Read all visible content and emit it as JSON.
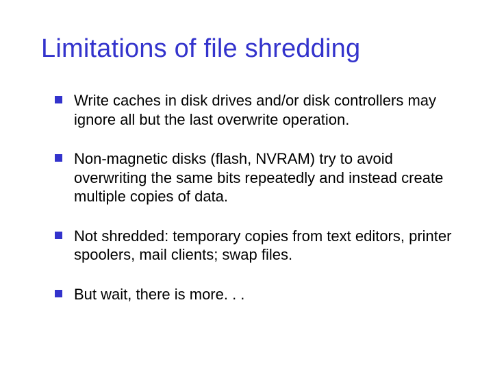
{
  "title": "Limitations of file shredding",
  "bullets": [
    "Write caches in disk drives and/or disk controllers may ignore all but the last overwrite operation.",
    "Non-magnetic disks (flash, NVRAM) try to avoid overwriting the same bits repeatedly and instead create multiple copies of data.",
    "Not shredded: temporary copies from text editors, printer spoolers, mail clients; swap files.",
    "But wait, there is more. . ."
  ]
}
